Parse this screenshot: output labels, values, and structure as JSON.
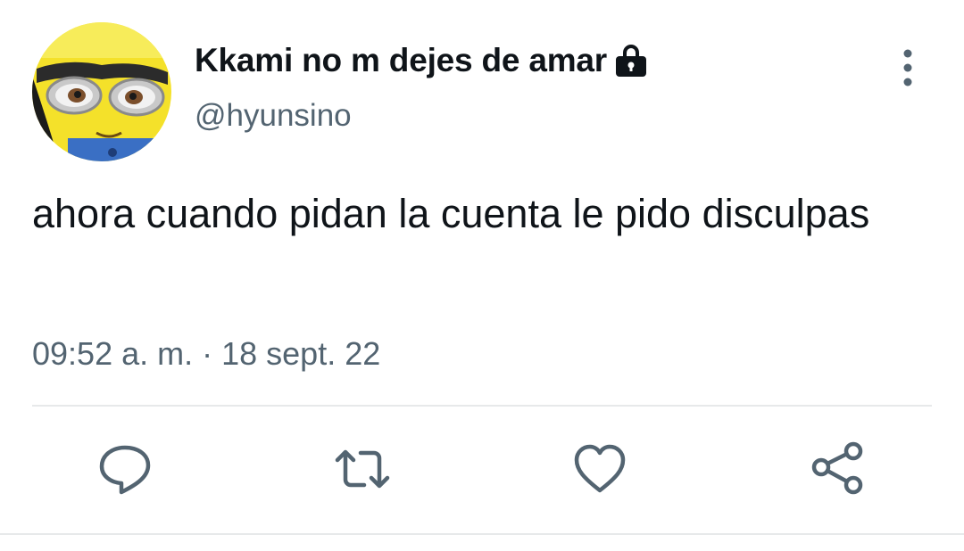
{
  "tweet": {
    "author": {
      "display_name": "Kkami no m dejes de amar",
      "handle": "@hyunsino",
      "protected_icon": "lock-icon",
      "avatar": "minion-avatar"
    },
    "text": "ahora cuando pidan la cuenta le pido disculpas",
    "time": "09:52 a. m.",
    "separator": "·",
    "date": "18 sept. 22",
    "actions": [
      {
        "name": "reply",
        "icon": "reply-icon"
      },
      {
        "name": "retweet",
        "icon": "retweet-icon"
      },
      {
        "name": "like",
        "icon": "heart-icon"
      },
      {
        "name": "share",
        "icon": "share-icon"
      }
    ],
    "more_icon": "more-vertical-icon"
  },
  "colors": {
    "text_primary": "#0f1419",
    "text_secondary": "#536471",
    "divider": "#e7e9ea"
  }
}
